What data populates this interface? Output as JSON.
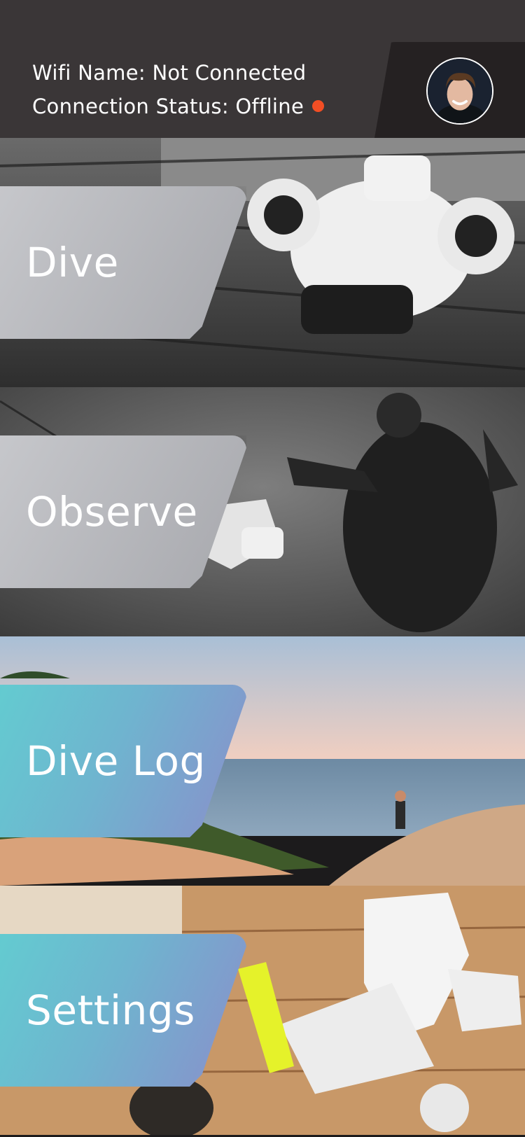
{
  "header": {
    "wifi_name_label": "Wifi Name:",
    "wifi_name_value": "Not Connected",
    "connection_status_label": "Connection Status:",
    "connection_status_value": "Offline",
    "status_color": "#f24e24"
  },
  "profile": {
    "avatar_icon": "user-avatar"
  },
  "menu": {
    "items": [
      {
        "label": "Dive",
        "style": "gray",
        "background": "drone-on-dock-photo"
      },
      {
        "label": "Observe",
        "style": "gray",
        "background": "diver-underwater-photo"
      },
      {
        "label": "Dive Log",
        "style": "gradient",
        "background": "lakeshore-dune-photo"
      },
      {
        "label": "Settings",
        "style": "gradient",
        "background": "workbench-drone-photo"
      }
    ]
  },
  "colors": {
    "header_bg": "#3a3637",
    "profile_tab_bg": "#252122",
    "gray_card_start": "#c6c7cb",
    "gradient_card_start": "#63cbd0",
    "gradient_card_end": "#8a8ecb"
  }
}
